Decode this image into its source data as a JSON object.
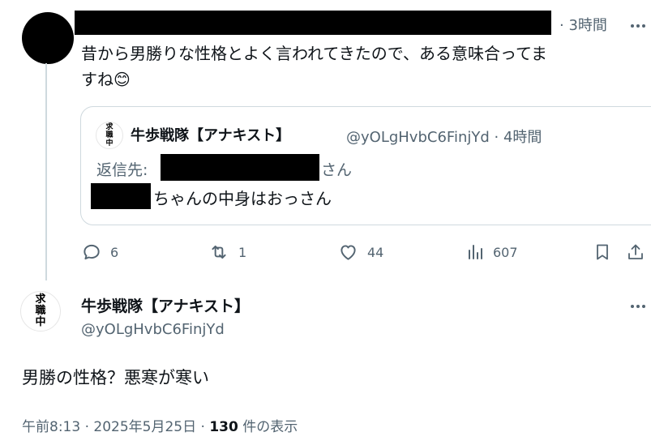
{
  "reply": {
    "time": "· 3時間",
    "text_line1": "昔から男勝りな性格とよく言われてきたので、ある意味合ってま",
    "text_line2": "すね",
    "emoji": "😊"
  },
  "quote": {
    "avatar_text": [
      "求",
      "職",
      "中"
    ],
    "name": "牛歩戦隊【アナキスト】",
    "handle_time": "@yOLgHvbC6FinjYd · 4時間",
    "reply_to_label": "返信先:",
    "reply_to_suffix": "さん",
    "text": "ちゃんの中身はおっさん"
  },
  "actions": {
    "replies": "6",
    "retweets": "1",
    "likes": "44",
    "views": "607"
  },
  "main": {
    "avatar_text": [
      "求",
      "職",
      "中"
    ],
    "name": "牛歩戦隊【アナキスト】",
    "handle": "@yOLgHvbC6FinjYd",
    "text": "男勝の性格？悪寒が寒い",
    "meta_prefix": "午前8:13 · 2025年5月25日 · ",
    "view_count": "130",
    "view_suffix": " 件の表示"
  },
  "colors": {
    "muted": "#536471",
    "border": "#cfd9de",
    "text": "#0f1419"
  }
}
